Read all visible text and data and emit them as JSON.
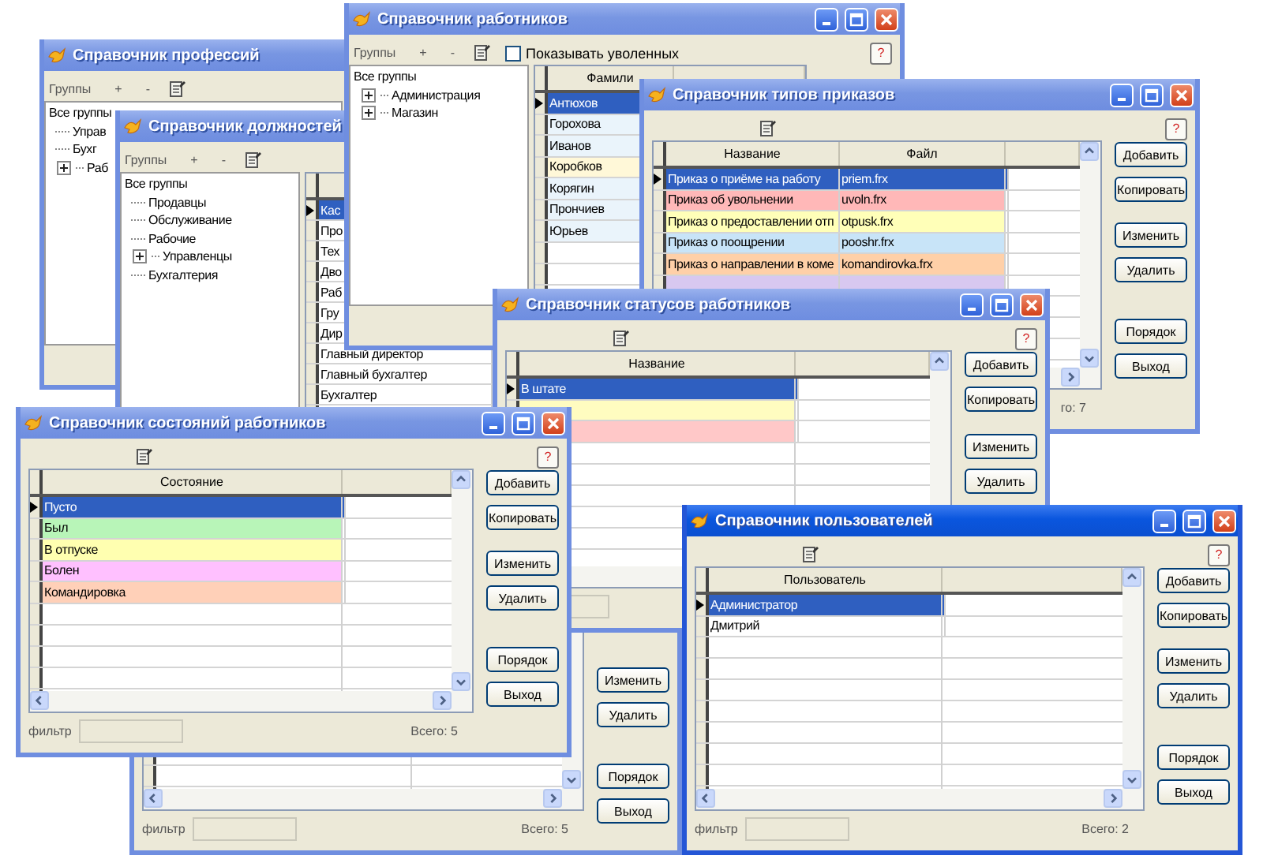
{
  "windows": [
    {
      "title": "Справочник профессий",
      "active": false,
      "toolbar": {
        "label": "Группы",
        "buttons": [
          "+",
          "-"
        ]
      },
      "tree": [
        {
          "label": "Все группы",
          "children": [
            {
              "label": "Управ"
            },
            {
              "label": "Бухг"
            },
            {
              "label": "Раб",
              "expanded": false
            }
          ]
        }
      ]
    },
    {
      "title": "Справочник должностей",
      "active": false,
      "toolbar": {
        "label": "Группы",
        "buttons": [
          "+",
          "-"
        ]
      },
      "tree": [
        {
          "label": "Все группы",
          "children": [
            {
              "label": "Продавцы"
            },
            {
              "label": "Обслуживание"
            },
            {
              "label": "Рабочие"
            },
            {
              "label": "Управленцы",
              "expanded": false
            },
            {
              "label": "Бухгалтерия"
            }
          ]
        }
      ],
      "grid": {
        "rows": [
          {
            "cells": [
              "Кас"
            ],
            "selected": true
          },
          {
            "cells": [
              "Про"
            ],
            "selected": false
          },
          {
            "cells": [
              "Тех"
            ],
            "selected": false
          },
          {
            "cells": [
              "Дво"
            ],
            "selected": false
          },
          {
            "cells": [
              "Раб"
            ],
            "selected": false
          },
          {
            "cells": [
              "Гру"
            ],
            "selected": false
          },
          {
            "cells": [
              "Дир"
            ],
            "selected": false
          },
          {
            "cells": [
              "Главный директор"
            ],
            "selected": false
          },
          {
            "cells": [
              "Главный бухгалтер"
            ],
            "selected": false
          },
          {
            "cells": [
              "Бухгалтер"
            ],
            "selected": false
          }
        ]
      }
    },
    {
      "button_groups": [
        [
          "Изменить",
          "Удалить"
        ],
        [
          "Порядок",
          "Выход"
        ]
      ],
      "filter_label": "фильтр",
      "filter_field": true,
      "total": "Всего: 5"
    },
    {
      "title": "Справочник работников",
      "active": false,
      "toolbar": {
        "label": "Группы",
        "buttons": [
          "+",
          "-"
        ],
        "checkbox": {
          "label": "Показывать уволенных",
          "checked": false
        }
      },
      "help": "?",
      "tree": [
        {
          "label": "Все группы",
          "children": [
            {
              "label": "Администрация",
              "expanded": false
            },
            {
              "label": "Магазин",
              "expanded": false
            }
          ]
        }
      ],
      "grid": {
        "columns": [
          "Фамили"
        ],
        "rows": [
          {
            "cells": [
              "Антюхов"
            ],
            "selected": true
          },
          {
            "cells": [
              "Горохова"
            ],
            "selected": false,
            "color": "#eaf4fb"
          },
          {
            "cells": [
              "Иванов"
            ],
            "selected": false,
            "color": "#eaf4fb"
          },
          {
            "cells": [
              "Коробков"
            ],
            "selected": false,
            "color": "#fff8d8"
          },
          {
            "cells": [
              "Корягин"
            ],
            "selected": false,
            "color": "#eaf4fb"
          },
          {
            "cells": [
              "Прончиев"
            ],
            "selected": false,
            "color": "#eaf4fb"
          },
          {
            "cells": [
              "Юрьев"
            ],
            "selected": false,
            "color": "#eaf4fb"
          }
        ]
      }
    },
    {
      "title": "Справочник типов приказов",
      "active": false,
      "help": "?",
      "grid": {
        "columns": [
          "Название",
          "Файл"
        ],
        "rows": [
          {
            "cells": [
              "Приказ о приёме на работу",
              "priem.frx"
            ],
            "selected": true
          },
          {
            "cells": [
              "Приказ об увольнении",
              "uvoln.frx"
            ],
            "selected": false,
            "color": "#ffb8b8"
          },
          {
            "cells": [
              "Приказ о предоставлении отп",
              "otpusk.frx"
            ],
            "selected": false,
            "color": "#ffffb8"
          },
          {
            "cells": [
              "Приказ о поощрении",
              "pooshr.frx"
            ],
            "selected": false,
            "color": "#c8e4f8"
          },
          {
            "cells": [
              "Приказ о направлении в коме",
              "komandirovka.frx"
            ],
            "selected": false,
            "color": "#ffd0a8"
          },
          {
            "selected": false,
            "color": "#d8c8f0"
          }
        ]
      },
      "button_groups": [
        [
          "Добавить",
          "Копировать"
        ],
        [
          "Изменить",
          "Удалить"
        ],
        [
          "Порядок",
          "Выход"
        ]
      ],
      "total": "го: 7"
    },
    {
      "title": "Справочник статусов работников",
      "active": false,
      "help": "?",
      "grid": {
        "columns": [
          "Название"
        ],
        "rows": [
          {
            "cells": [
              "В штате"
            ],
            "selected": true
          },
          {
            "selected": false,
            "color": "#fffcc0"
          },
          {
            "selected": false,
            "color": "#ffc8c8"
          }
        ]
      },
      "button_groups": [
        [
          "Добавить",
          "Копировать"
        ],
        [
          "Изменить",
          "Удалить"
        ]
      ],
      "filter_field": true
    },
    {
      "title": "Справочник состояний работников",
      "active": false,
      "help": "?",
      "grid": {
        "columns": [
          "Состояние"
        ],
        "rows": [
          {
            "cells": [
              "Пусто"
            ],
            "selected": true
          },
          {
            "cells": [
              "Был"
            ],
            "selected": false,
            "color": "#b8f5b8"
          },
          {
            "cells": [
              "В отпуске"
            ],
            "selected": false,
            "color": "#ffffb0"
          },
          {
            "cells": [
              "Болен"
            ],
            "selected": false,
            "color": "#ffc0ff"
          },
          {
            "cells": [
              "Командировка"
            ],
            "selected": false,
            "color": "#ffd0b8"
          }
        ]
      },
      "button_groups": [
        [
          "Добавить",
          "Копировать"
        ],
        [
          "Изменить",
          "Удалить"
        ],
        [
          "Порядок",
          "Выход"
        ]
      ],
      "filter_label": "фильтр",
      "filter_field": true,
      "total": "Всего: 5"
    },
    {
      "title": "Справочник пользователей",
      "active": true,
      "help": "?",
      "grid": {
        "columns": [
          "Пользователь"
        ],
        "rows": [
          {
            "cells": [
              "Администратор"
            ],
            "selected": true
          },
          {
            "cells": [
              "Дмитрий"
            ],
            "selected": false
          }
        ]
      },
      "button_groups": [
        [
          "Добавить",
          "Копировать"
        ],
        [
          "Изменить",
          "Удалить"
        ],
        [
          "Порядок",
          "Выход"
        ]
      ],
      "filter_label": "фильтр",
      "filter_field": true,
      "total": "Всего: 2"
    }
  ]
}
